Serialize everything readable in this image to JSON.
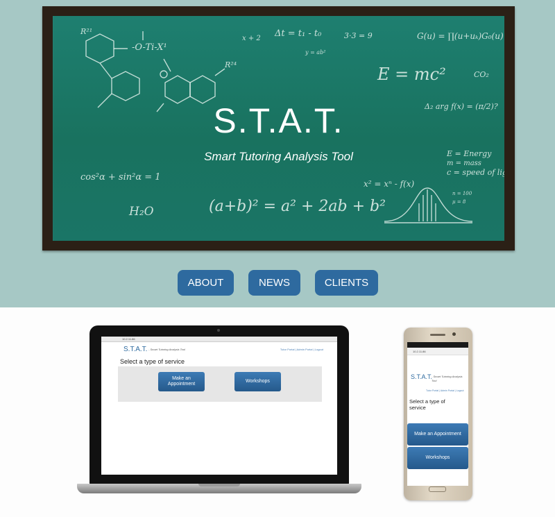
{
  "hero": {
    "title": "S.T.A.T.",
    "subtitle": "Smart Tutoring Analysis Tool",
    "chalk_formulas": [
      "Δt = t₁ - t₀",
      "3·3 = 9",
      "G(u) = ∏(u+uₖ)G₀(u)",
      "y = ab²",
      "E = mc²",
      "CO₂",
      "Δ₂ arg f(x) = (π/2)?",
      "E = Energy",
      "m = mass",
      "c = speed of light",
      "cos²α + sin²α = 1",
      "x² = xⁿ - f(x)",
      "H₂O",
      "(a+b)² = a² + 2ab + b²",
      "x + 2",
      "n = 100",
      "μ = 8"
    ]
  },
  "nav": {
    "about": "ABOUT",
    "news": "NEWS",
    "clients": "CLIENTS"
  },
  "laptop": {
    "url": "10.2.11.86",
    "logo": "S.T.A.T.",
    "tagline": "- Smart Tutoring Analysis Tool",
    "links": "Tutor Portal  |  Admin Portal  |  Logout",
    "heading": "Select a type of service",
    "btn_appointment": "Make an Appointment",
    "btn_workshops": "Workshops"
  },
  "phone": {
    "url": "10.2.11.86",
    "logo": "S.T.A.T.",
    "tagline": "- Smart Tutoring Analysis Tool",
    "links": "Tutor Portal  |  Admin Portal  |  Logout",
    "heading": "Select a type of service",
    "btn_appointment": "Make an Appointment",
    "btn_workshops": "Workshops"
  },
  "colors": {
    "hero_bg": "#a6c8c5",
    "chalkboard": "#1b7a6b",
    "frame": "#2b2016",
    "button": "#2e6a9f"
  }
}
